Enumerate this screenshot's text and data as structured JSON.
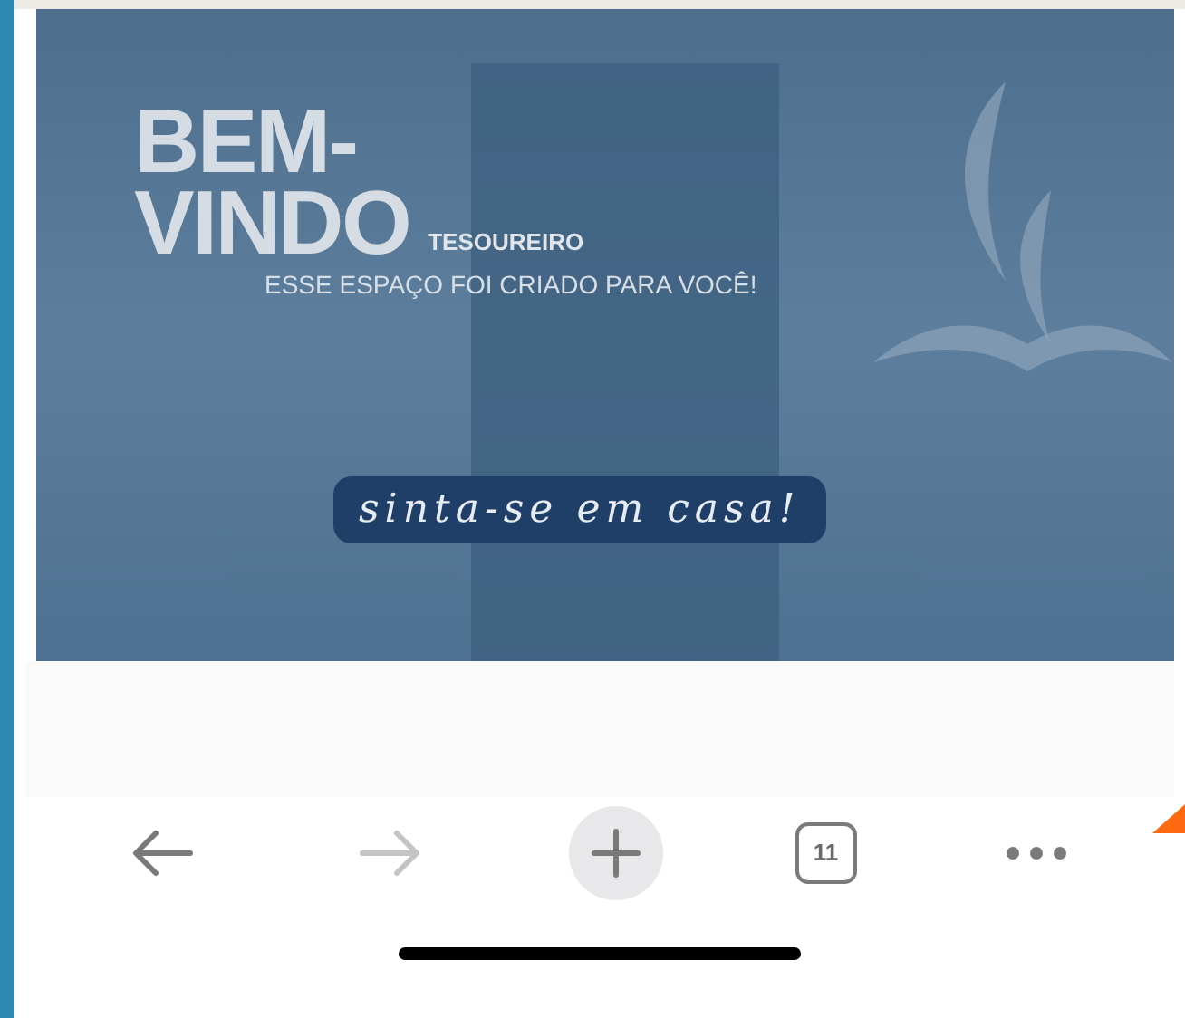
{
  "banner": {
    "heading_line_1": "BEM-",
    "heading_line_2": "VINDO",
    "role": "TESOUREIRO",
    "subtitle": "ESSE ESPAÇO FOI CRIADO PARA VOCÊ!",
    "tagline": "sinta-se em casa!"
  },
  "toolbar": {
    "buttons": [
      {
        "kind": "back",
        "disabled": false
      },
      {
        "kind": "forward",
        "disabled": true
      },
      {
        "kind": "new-tab",
        "disabled": false
      },
      {
        "kind": "tabs",
        "disabled": false,
        "count": "11"
      },
      {
        "kind": "more",
        "disabled": false
      }
    ]
  }
}
